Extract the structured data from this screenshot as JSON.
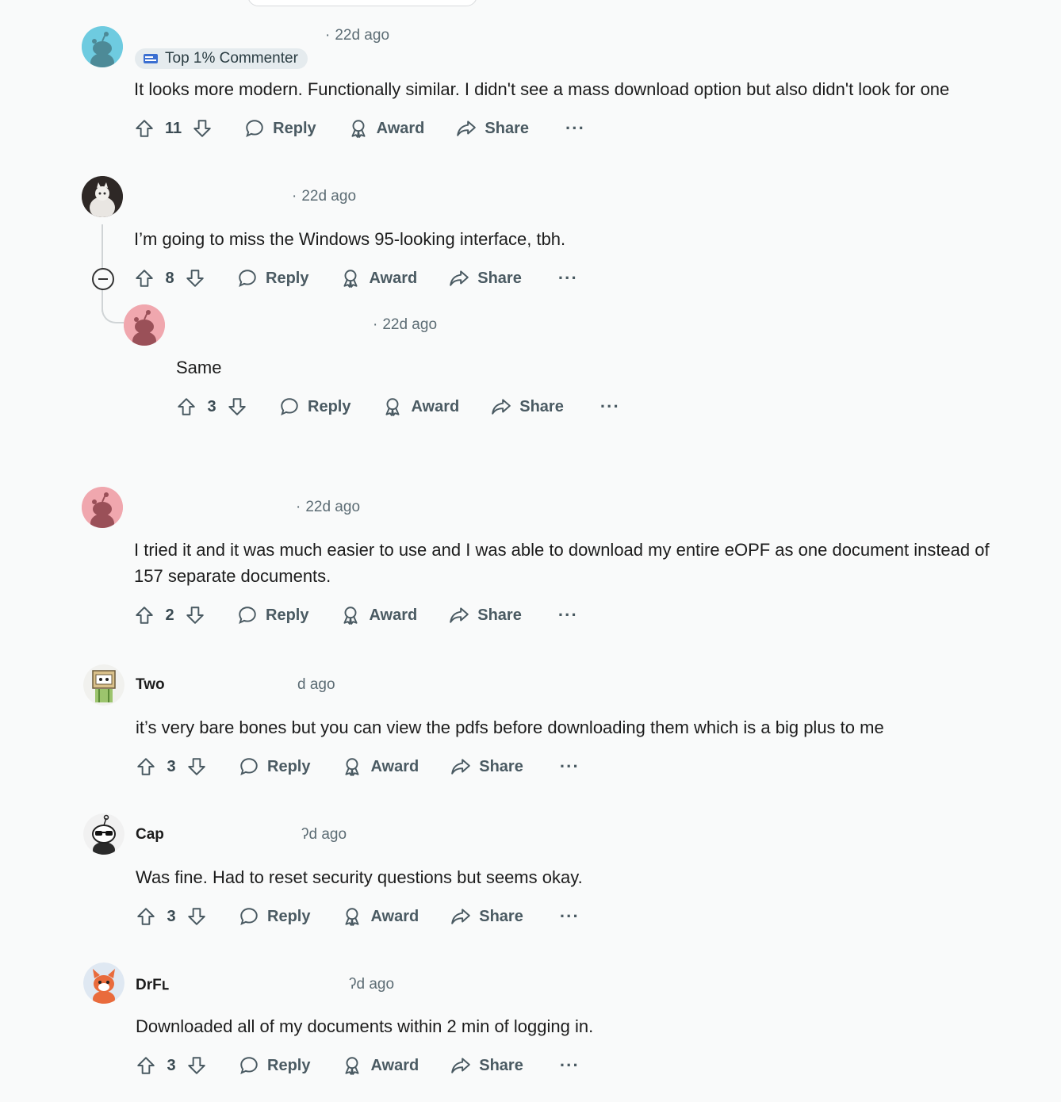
{
  "comments": [
    {
      "time": "22d ago",
      "flair": "Top 1% Commenter",
      "text": "It looks more modern. Functionally similar. I didn't see a mass download option but also didn't look for one",
      "votes": "11",
      "avatar_color": "#6ecbe0"
    },
    {
      "time": "22d ago",
      "text": "I’m going to miss the Windows 95-looking interface, tbh.",
      "votes": "8",
      "avatar_color": "#3a3330"
    },
    {
      "time": "22d ago",
      "text": "Same",
      "votes": "3",
      "avatar_color": "#f0a7ae"
    },
    {
      "time": "22d ago",
      "text": "I tried it and it was much easier to use and I was able to download my entire eOPF as one document instead of 157 separate documents.",
      "votes": "2",
      "avatar_color": "#f0a7ae"
    },
    {
      "author": "Two",
      "time": "d ago",
      "text": "it’s very bare bones but you can view the pdfs before downloading them which is a big plus to me",
      "votes": "3",
      "avatar_color": "#e8d9a8"
    },
    {
      "author": "Cap",
      "time": "ʔd ago",
      "text": "Was fine. Had to reset security questions but seems okay.",
      "votes": "3",
      "avatar_color": "#ffffff"
    },
    {
      "author": "DrFւ",
      "time": "ʔd ago",
      "text": "Downloaded all of my documents within 2 min of logging in.",
      "votes": "3",
      "avatar_color": "#e96b3c"
    }
  ],
  "actions": {
    "reply": "Reply",
    "award": "Award",
    "share": "Share",
    "more": "···"
  },
  "separator": "·",
  "icons": {
    "upvote": "upvote-arrow-icon",
    "downvote": "downvote-arrow-icon",
    "reply": "speech-bubble-icon",
    "award": "award-ribbon-icon",
    "share": "share-arrow-icon",
    "collapse": "collapse-minus-icon"
  }
}
